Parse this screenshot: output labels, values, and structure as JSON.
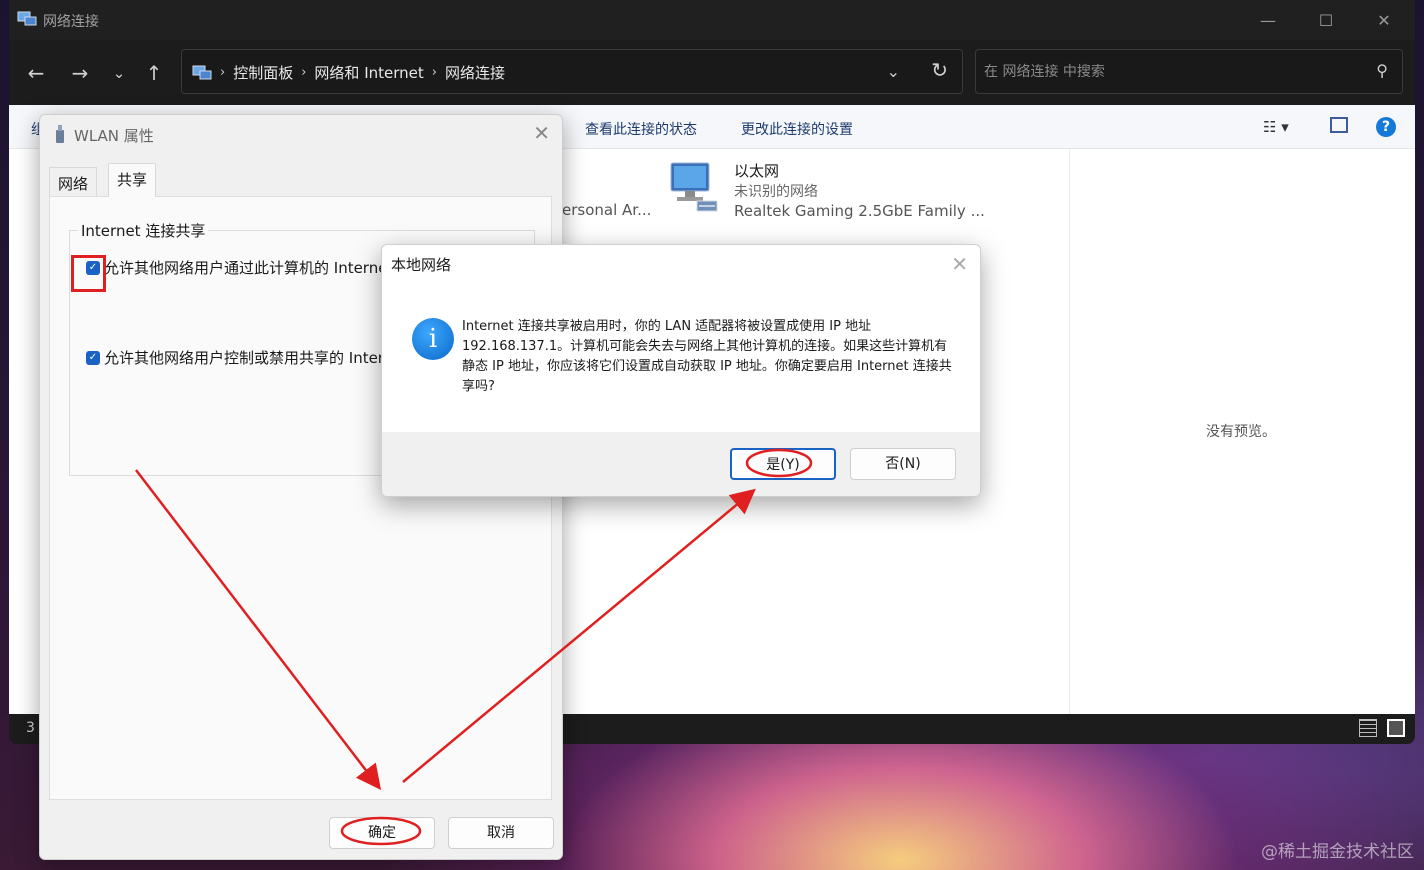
{
  "explorer": {
    "title": "网络连接",
    "breadcrumbs": [
      "控制面板",
      "网络和 Internet",
      "网络连接"
    ],
    "search_placeholder": "在 网络连接 中搜索",
    "commands": [
      "查看此连接的状态",
      "更改此连接的设置"
    ],
    "partial_command": "组",
    "ethernet": {
      "name": "以太网",
      "status": "未识别的网络",
      "adapter": "Realtek Gaming 2.5GbE Family ..."
    },
    "partial_connection": "ersonal Ar...",
    "preview_message": "没有预览。",
    "item_count": "3"
  },
  "wlan_dialog": {
    "title": "WLAN 属性",
    "tabs": [
      "网络",
      "共享"
    ],
    "group_label": "Internet 连接共享",
    "checkbox1": "允许其他网络用户通过此计算机的 Internet",
    "checkbox2": "允许其他网络用户控制或禁用共享的 Internet",
    "ok": "确定",
    "cancel": "取消"
  },
  "confirm_dialog": {
    "title": "本地网络",
    "message": "Internet 连接共享被启用时，你的 LAN 适配器将被设置成使用 IP 地址 192.168.137.1。计算机可能会失去与网络上其他计算机的连接。如果这些计算机有静态 IP 地址，你应该将它们设置成自动获取 IP 地址。你确定要启用 Internet 连接共享吗?",
    "yes": "是(Y)",
    "no": "否(N)"
  },
  "watermark": "@稀土掘金技术社区",
  "colors": {
    "accent": "#1a62c4",
    "annotation": "#e02020"
  }
}
